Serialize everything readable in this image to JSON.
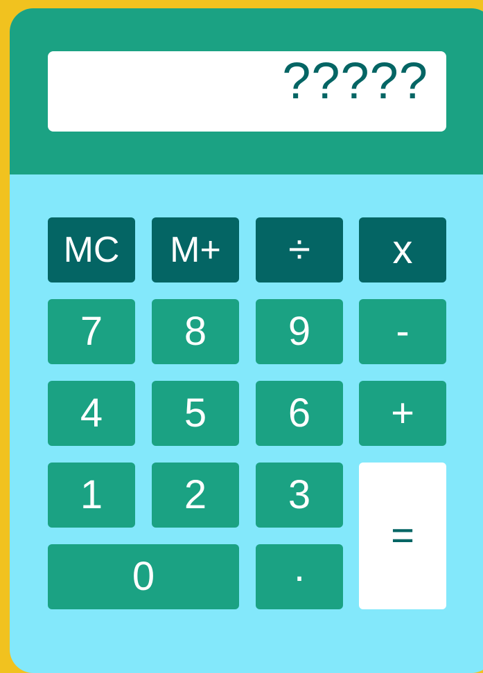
{
  "display": {
    "value": "?????"
  },
  "keys": {
    "mc": "MC",
    "m_plus": "M+",
    "divide": "÷",
    "multiply": "x",
    "seven": "7",
    "eight": "8",
    "nine": "9",
    "minus": "-",
    "four": "4",
    "five": "5",
    "six": "6",
    "plus": "+",
    "one": "1",
    "two": "2",
    "three": "3",
    "zero": "0",
    "decimal": "·",
    "equals": "="
  },
  "colors": {
    "background": "#f1c21f",
    "body": "#83e8fb",
    "header": "#1ba283",
    "key_dark": "#046564",
    "key_green": "#1ba283",
    "display_text": "#046564",
    "display_bg": "#ffffff"
  }
}
